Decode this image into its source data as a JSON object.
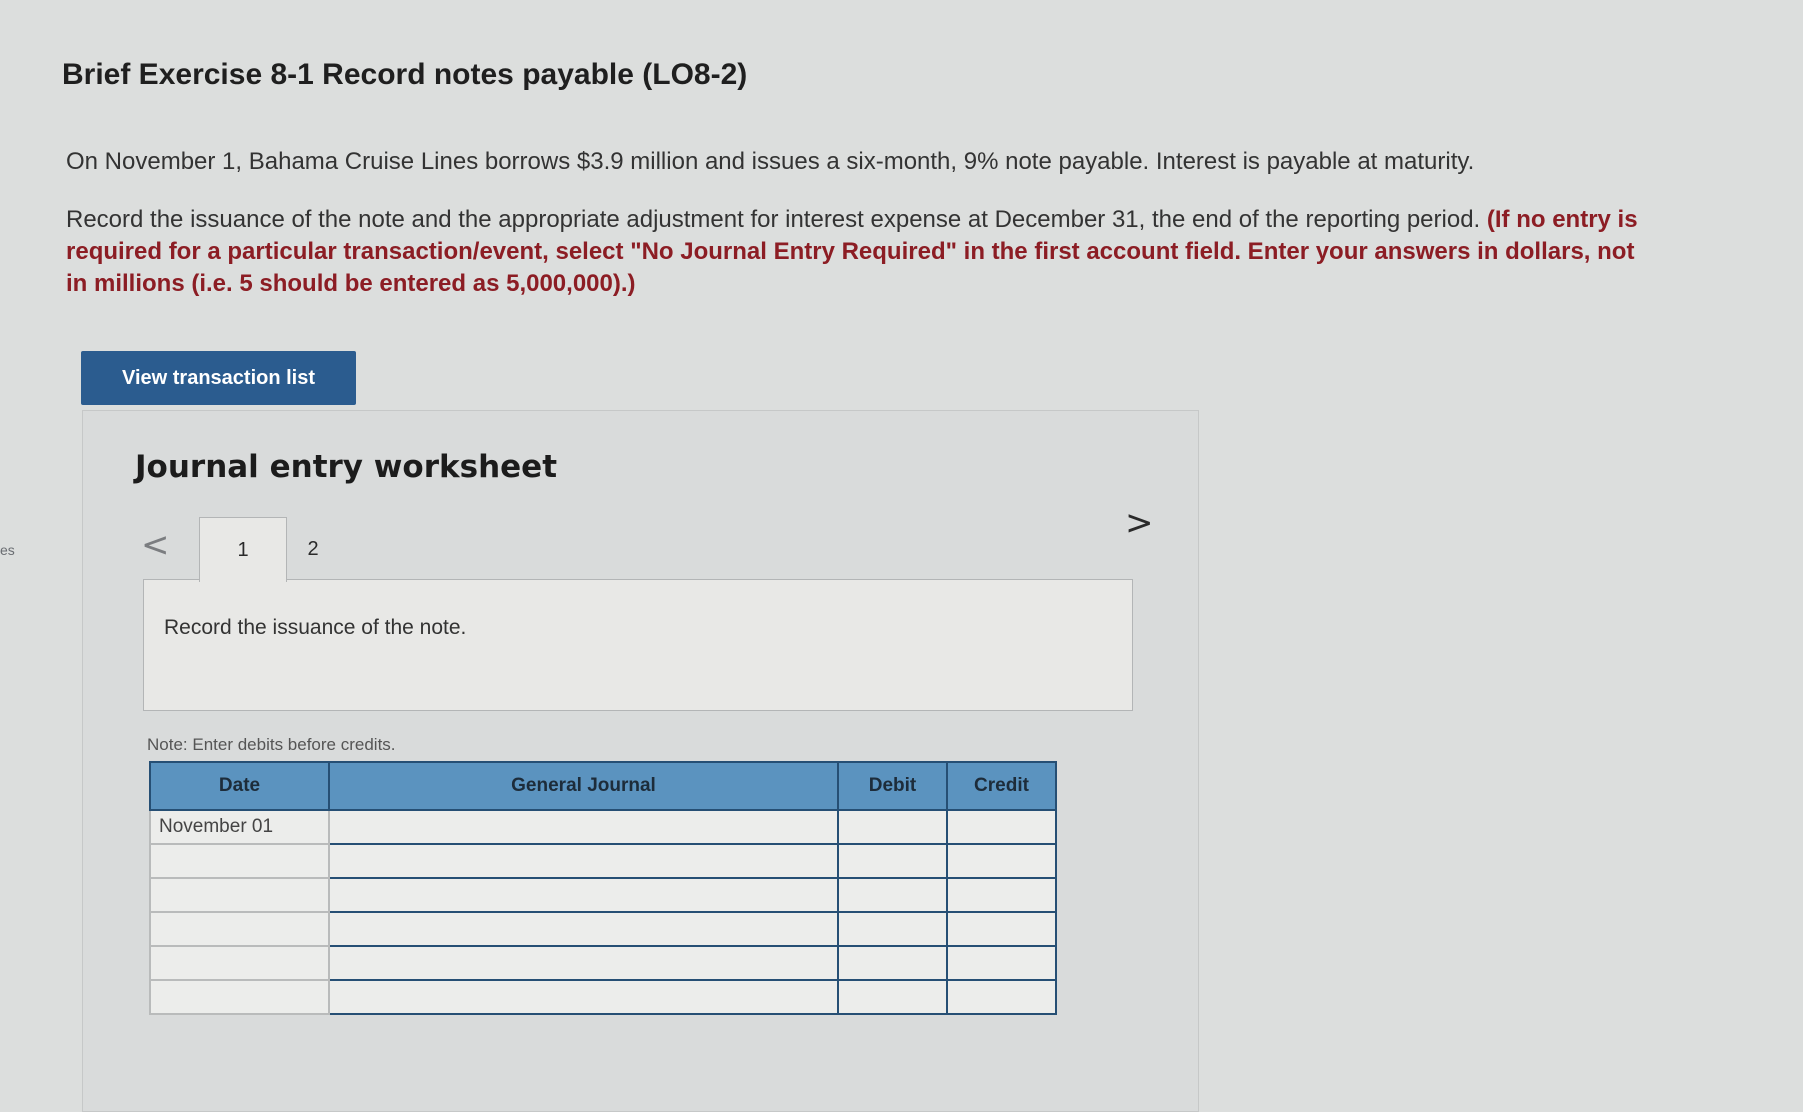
{
  "edge_text": "es",
  "title": "Brief Exercise 8-1 Record notes payable (LO8-2)",
  "problem": {
    "paragraph1": "On November 1, Bahama Cruise Lines borrows $3.9 million and issues a six-month, 9% note payable. Interest is payable at maturity.",
    "paragraph2": "Record the issuance of the note and the appropriate adjustment for interest expense at December 31, the end of the reporting period.",
    "paragraph2_emph": "(If no entry is required for a particular transaction/event, select \"No Journal Entry Required\" in the first account field. Enter your answers in dollars, not in millions (i.e. 5 should be entered as 5,000,000).)"
  },
  "buttons": {
    "view_transaction_list": "View transaction list"
  },
  "worksheet": {
    "title": "Journal entry worksheet",
    "prev_icon": "chevron-left-icon",
    "next_icon": "chevron-right-icon",
    "prev_glyph": "<",
    "next_glyph": ">",
    "tabs": [
      {
        "label": "1",
        "active": true
      },
      {
        "label": "2",
        "active": false
      }
    ],
    "instruction": "Record the issuance of the note.",
    "note": "Note: Enter debits before credits."
  },
  "journal": {
    "headers": {
      "date": "Date",
      "general_journal": "General Journal",
      "debit": "Debit",
      "credit": "Credit"
    },
    "rows": [
      {
        "date": "November 01",
        "account": "",
        "debit": "",
        "credit": ""
      },
      {
        "date": "",
        "account": "",
        "debit": "",
        "credit": ""
      },
      {
        "date": "",
        "account": "",
        "debit": "",
        "credit": ""
      },
      {
        "date": "",
        "account": "",
        "debit": "",
        "credit": ""
      },
      {
        "date": "",
        "account": "",
        "debit": "",
        "credit": ""
      },
      {
        "date": "",
        "account": "",
        "debit": "",
        "credit": ""
      }
    ]
  },
  "colors": {
    "button_bg": "#2b5c8f",
    "table_header_bg": "#5b93bf",
    "table_border": "#264f74",
    "emphasis_text": "#8c1d24"
  }
}
